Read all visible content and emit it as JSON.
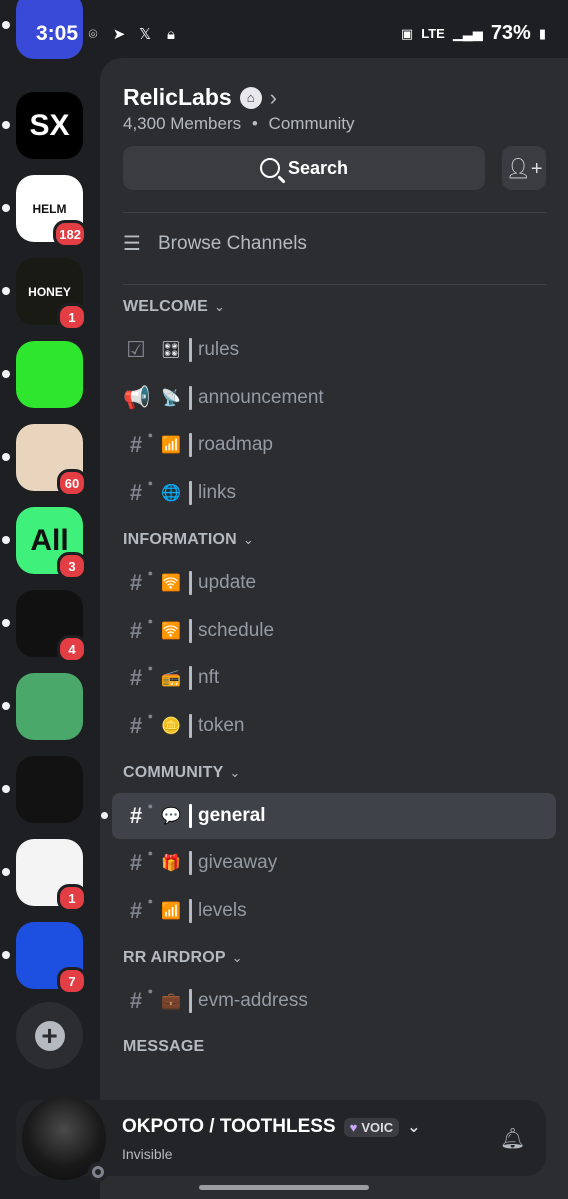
{
  "status_bar": {
    "time": "3:05",
    "network": "LTE",
    "battery": "73%",
    "notification_icons": [
      "messenger-icon",
      "telegram-icon",
      "x-icon",
      "lock-icon"
    ]
  },
  "servers": [
    {
      "name": "server-1",
      "color": "#3a4ad8",
      "glyph": "",
      "badge": null
    },
    {
      "name": "server-sx",
      "color": "#000000",
      "glyph": "SX",
      "badge": null
    },
    {
      "name": "server-helm",
      "color": "#ffffff",
      "glyph": "HELM",
      "badge": "182"
    },
    {
      "name": "server-honey",
      "color": "#1a1a14",
      "glyph": "HONEY",
      "badge": "1"
    },
    {
      "name": "server-green",
      "color": "#2ee62e",
      "glyph": "",
      "badge": null
    },
    {
      "name": "server-cat",
      "color": "#e9d4bd",
      "glyph": "",
      "badge": "60"
    },
    {
      "name": "server-all",
      "color": "#3ff07a",
      "glyph": "All",
      "badge": "3"
    },
    {
      "name": "server-pattern",
      "color": "#111111",
      "glyph": "",
      "badge": "4"
    },
    {
      "name": "server-bird",
      "color": "#4aa86b",
      "glyph": "",
      "badge": null
    },
    {
      "name": "server-fist",
      "color": "#121212",
      "glyph": "",
      "badge": null
    },
    {
      "name": "server-pink",
      "color": "#f4f4f4",
      "glyph": "",
      "badge": "1"
    },
    {
      "name": "server-e",
      "color": "#1d4fe0",
      "glyph": "",
      "badge": "7"
    }
  ],
  "guild": {
    "name": "RelicLabs",
    "members": "4,300 Members",
    "separator": "•",
    "type": "Community",
    "search_label": "Search",
    "browse_label": "Browse Channels"
  },
  "categories": [
    {
      "label": "WELCOME",
      "channels": [
        {
          "icon": "rules",
          "emoji": "🎛",
          "name": "rules"
        },
        {
          "icon": "announce",
          "emoji": "📡",
          "name": "announcement"
        },
        {
          "icon": "hash",
          "emoji": "📶",
          "name": "roadmap"
        },
        {
          "icon": "hash",
          "emoji": "🌐",
          "name": "links"
        }
      ]
    },
    {
      "label": "INFORMATION",
      "channels": [
        {
          "icon": "hash",
          "emoji": "🛜",
          "name": "update"
        },
        {
          "icon": "hash",
          "emoji": "🛜",
          "name": "schedule"
        },
        {
          "icon": "hash",
          "emoji": "📻",
          "name": "nft"
        },
        {
          "icon": "hash",
          "emoji": "🪙",
          "name": "token"
        }
      ]
    },
    {
      "label": "COMMUNITY",
      "channels": [
        {
          "icon": "hash",
          "emoji": "💬",
          "name": "general",
          "selected": true
        },
        {
          "icon": "hash",
          "emoji": "🎁",
          "name": "giveaway"
        },
        {
          "icon": "hash",
          "emoji": "📶",
          "name": "levels"
        }
      ]
    },
    {
      "label": "RR AIRDROP",
      "channels": [
        {
          "icon": "hash",
          "emoji": "💼",
          "name": "evm-address"
        }
      ]
    },
    {
      "label": "MESSAGE",
      "channels": []
    }
  ],
  "user": {
    "name": "OKPOTO / TOOTHLESS",
    "tag": "VOIC",
    "status": "Invisible"
  },
  "colors": {
    "accent_badge": "#e23e44",
    "panel": "#2b2d31",
    "rail": "#1e1f22"
  }
}
